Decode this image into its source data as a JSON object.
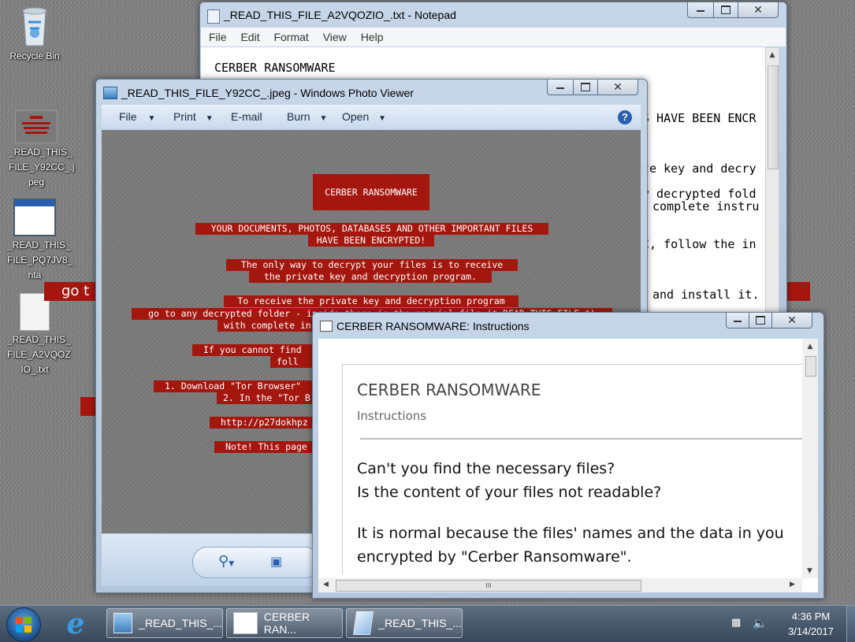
{
  "desktop": {
    "icons": [
      {
        "label": "Recycle Bin"
      },
      {
        "label": "_READ_THIS_ FILE_Y92CC_.j peg"
      },
      {
        "label": "_READ_THIS_ FILE_PQ7JV8_ hta"
      },
      {
        "label": "_READ_THIS_ FILE_A2VQOZ IO_.txt"
      }
    ],
    "overlay_fragment": "go t"
  },
  "notepad": {
    "title": "_READ_THIS_FILE_A2VQOZIO_.txt - Notepad",
    "menu": [
      "File",
      "Edit",
      "Format",
      "View",
      "Help"
    ],
    "lines": [
      "CERBER RANSOMWARE",
      "S HAVE BEEN ENCR",
      "te key and decry",
      "y decrypted fold",
      "complete instru",
      "C, follow the in",
      "and install it."
    ]
  },
  "photo_viewer": {
    "title": "_READ_THIS_FILE_Y92CC_.jpeg - Windows Photo Viewer",
    "toolbar": [
      "File",
      "Print",
      "E-mail",
      "Burn",
      "Open"
    ],
    "image": {
      "heading": "CERBER RANSOMWARE",
      "lines": [
        "YOUR DOCUMENTS, PHOTOS, DATABASES AND OTHER IMPORTANT FILES",
        "HAVE BEEN ENCRYPTED!",
        "The only way to decrypt your files is to receive",
        "the private key and decryption program.",
        "To receive the private key and decryption program",
        "go to any decrypted folder - inside there is the special file (*_READ_THIS_FILE_*)",
        "with complete in",
        "If you cannot find",
        "foll",
        "1. Download \"Tor Browser\"",
        "2. In the \"Tor B",
        "http://p27dokhpz",
        "Note! This page"
      ]
    }
  },
  "instructions_window": {
    "title": "CERBER RANSOMWARE: Instructions",
    "heading": "CERBER RANSOMWARE",
    "subheading": "Instructions",
    "para1_line1": "Can't you find the necessary files?",
    "para1_line2": "Is the content of your files not readable?",
    "para2_line1": "It is normal because the files' names and the data in you",
    "para2_line2": "encrypted by \"Cerber Ransomware\".",
    "scroll_thumb_glyph": "III"
  },
  "taskbar": {
    "buttons": [
      {
        "label": "_READ_THIS_..."
      },
      {
        "label": "CERBER RAN..."
      },
      {
        "label": "_READ_THIS_..."
      }
    ],
    "time": "4:36 PM",
    "date": "3/14/2017"
  },
  "colors": {
    "ransom_red": "#a4170f",
    "accent_blue": "#2a5fb0"
  }
}
